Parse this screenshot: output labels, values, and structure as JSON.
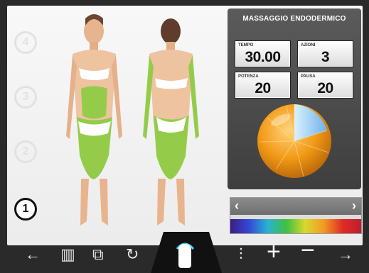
{
  "steps": [
    {
      "label": "4"
    },
    {
      "label": "3"
    },
    {
      "label": "2"
    },
    {
      "label": "1",
      "active": true
    }
  ],
  "treatment": {
    "title": "MASSAGGIO ENDODERMICO",
    "tempo": {
      "label": "TEMPO",
      "value": "30.00"
    },
    "azioni": {
      "label": "AZIONI",
      "value": "3"
    },
    "potenza": {
      "label": "POTENZA",
      "value": "20"
    },
    "pausa": {
      "label": "PAUSA",
      "value": "20"
    }
  },
  "controls": {
    "left_arrow": "‹",
    "right_arrow": "›"
  },
  "bottom": {
    "plus": "+",
    "minus": "−"
  },
  "colors": {
    "treatment_zone": "#94cc4a",
    "panel": "#4b4b4b",
    "sphere": "#f39b1c"
  }
}
